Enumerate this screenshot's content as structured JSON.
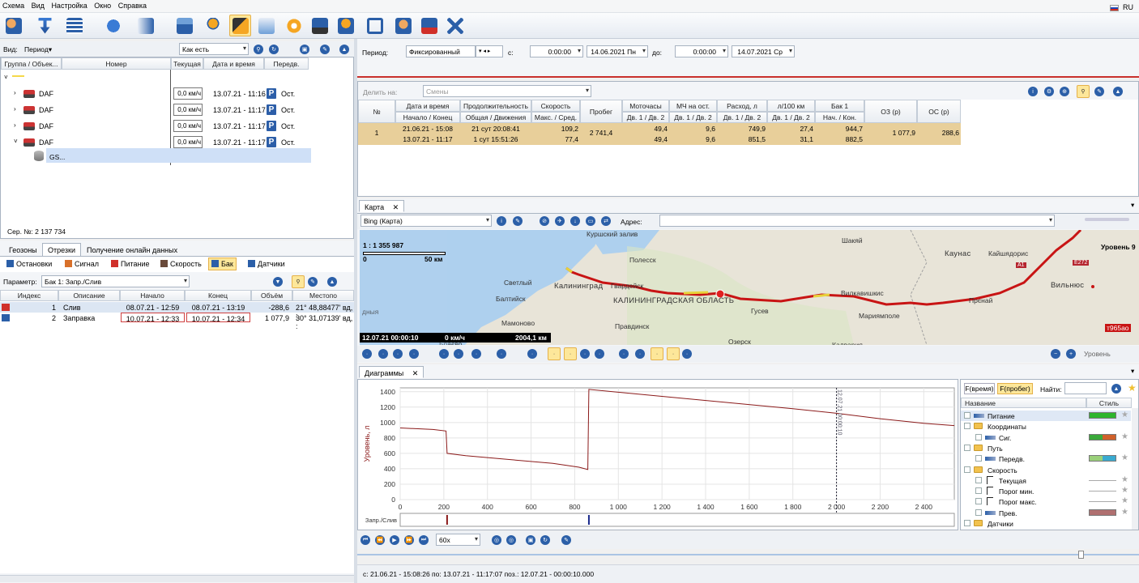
{
  "menu": [
    "Схема",
    "Вид",
    "Настройка",
    "Окно",
    "Справка"
  ],
  "lang": "RU",
  "left": {
    "view_label": "Вид:",
    "view_value": "Период",
    "mode_value": "Как есть",
    "columns": [
      "Группа / Объек...",
      "Номер",
      "Текущая",
      "Дата и время",
      "Передв."
    ],
    "rows": [
      {
        "name": "DAF",
        "speed": "0,0 км/ч",
        "dt": "13.07.21 - 11:16",
        "state": "Ост."
      },
      {
        "name": "DAF",
        "speed": "0,0 км/ч",
        "dt": "13.07.21 - 11:17",
        "state": "Ост."
      },
      {
        "name": "DAF",
        "speed": "0,0 км/ч",
        "dt": "13.07.21 - 11:17",
        "state": "Ост."
      },
      {
        "name": "DAF",
        "speed": "0,0 км/ч",
        "dt": "13.07.21 - 11:17",
        "state": "Ост."
      }
    ],
    "sub_item": "GS...",
    "serial": "Сер. №: 2 137 734",
    "tabs": [
      "Геозоны",
      "Отрезки",
      "Получение онлайн данных"
    ],
    "subtabs": [
      "Остановки",
      "Сигнал",
      "Питание",
      "Скорость",
      "Бак",
      "Датчики"
    ],
    "param_label": "Параметр:",
    "param_value": "Бак 1: Запр./Слив",
    "seg_columns": [
      "Индекс",
      "Описание",
      "Начало",
      "Конец",
      "Объём",
      "Местопо"
    ],
    "segments": [
      {
        "idx": "1",
        "desc": "Слив",
        "start": "08.07.21 - 12:59",
        "end": "08.07.21 - 13:19",
        "vol": "-288,6",
        "loc": "21° 48,88477' вд, :"
      },
      {
        "idx": "2",
        "desc": "Заправка",
        "start": "10.07.21 - 12:33",
        "end": "10.07.21 - 12:34",
        "vol": "1 077,9",
        "loc": "30° 31,07139' вд, :"
      }
    ]
  },
  "period": {
    "label": "Период:",
    "value": "Фиксированный",
    "from_label": "с:",
    "from_time": "0:00:00",
    "from_date": "14.06.2021 Пн",
    "to_label": "до:",
    "to_time": "0:00:00",
    "to_date": "14.07.2021 Ср"
  },
  "report": {
    "share_label": "Делить на:",
    "share_value": "Смены",
    "cols_top": [
      "№",
      "Дата и время",
      "Продолжительность",
      "Скорость",
      "Пробег",
      "Моточасы",
      "МЧ на ост.",
      "Расход, л",
      "л/100 км",
      "Бак 1",
      "ОЗ (р)",
      "ОС (р)"
    ],
    "cols_bottom": [
      "Начало / Конец",
      "Общая / Движения",
      "Макс. / Сред.",
      "Дв. 1 / Дв. 2",
      "Дв. 1 / Дв. 2",
      "Дв. 1 / Дв. 2",
      "Дв. 1 / Дв. 2",
      "Нач. / Кон."
    ],
    "row": {
      "num": "1",
      "dt1": "21.06.21 - 15:08",
      "dt2": "13.07.21 - 11:17",
      "dur1": "21 сут 20:08:41",
      "dur2": "1 сут 15:51:26",
      "sp1": "109,2",
      "sp2": "77,4",
      "mileage": "2 741,4",
      "mh1": "49,4",
      "mh2": "49,4",
      "mho1": "9,6",
      "mho2": "9,6",
      "fuel1": "749,9",
      "fuel2": "851,5",
      "l1001": "27,4",
      "l1002": "31,1",
      "tank1": "944,7",
      "tank2": "882,5",
      "oz": "1 077,9",
      "os": "288,6"
    }
  },
  "map": {
    "tab": "Карта",
    "provider": "Bing (Карта)",
    "addr_label": "Адрес:",
    "scale": "1 : 1 355 987",
    "scale_lbl0": "0",
    "scale_lbl1": "50 км",
    "status_date": "12.07.21 00:00:10",
    "status_speed": "0 км/ч",
    "status_dist": "2004,1 км",
    "level": "Уровень 9",
    "level_btn": "Уровень",
    "places": [
      "Куршский залив",
      "Полесск",
      "Светлый",
      "Калининград",
      "Гвардейск",
      "Балтийск",
      "КАЛИНИНГРАДСКАЯ ОБЛАСТЬ",
      "Гусев",
      "Мамоново",
      "Правдинск",
      "Озерск",
      "Шакяй",
      "Каунас",
      "Кайшядорис",
      "Вильнюс",
      "Прєнай",
      "Мариямполе",
      "Вилкавишкис",
      "Калвария",
      "Браєво",
      "дныя",
      "т965ао",
      "A1",
      "E272"
    ]
  },
  "chart": {
    "tab": "Диаграммы",
    "ylabel": "Уровень, л",
    "event_label": "Запр./Слив",
    "yticks": [
      "1400",
      "1200",
      "1000",
      "800",
      "600",
      "400",
      "200",
      "0"
    ],
    "xticks": [
      "0",
      "200",
      "400",
      "600",
      "800",
      "1 000",
      "1 200",
      "1 400",
      "1 600",
      "1 800",
      "2 000",
      "2 200",
      "2 400"
    ],
    "marker_text": "12.07.21 00:00:10"
  },
  "chart_data": {
    "type": "line",
    "title": "",
    "xlabel": "",
    "ylabel": "Уровень, л",
    "xlim": [
      0,
      2540
    ],
    "ylim": [
      0,
      1450
    ],
    "series": [
      {
        "name": "",
        "x": [
          0,
          150,
          210,
          215,
          300,
          500,
          700,
          820,
          860,
          865,
          1200,
          1500,
          1800,
          2000,
          2200,
          2400,
          2540
        ],
        "y": [
          930,
          910,
          890,
          600,
          570,
          520,
          470,
          420,
          390,
          1430,
          1340,
          1260,
          1180,
          1120,
          1050,
          990,
          960
        ]
      }
    ],
    "events": [
      {
        "x": 215,
        "color": "#8b1a1a"
      },
      {
        "x": 865,
        "color": "#1a2a8b"
      }
    ],
    "marker_x": 2000
  },
  "legend": {
    "btn_time": "F(время)",
    "btn_dist": "F(пробег)",
    "find_label": "Найти:",
    "col_name": "Название",
    "col_style": "Стиль",
    "items": [
      {
        "label": "Питание",
        "kind": "item",
        "indent": 0,
        "sw": "#2db52d"
      },
      {
        "label": "Координаты",
        "kind": "folder",
        "indent": 0
      },
      {
        "label": "Сиг.",
        "kind": "item",
        "indent": 1,
        "sw": "#3aa93a",
        "sw2": "#d0602a"
      },
      {
        "label": "Путь",
        "kind": "folder",
        "indent": 0
      },
      {
        "label": "Передв.",
        "kind": "item",
        "indent": 1,
        "sw": "#9ad07a",
        "sw2": "#3aaad0"
      },
      {
        "label": "Скорость",
        "kind": "folder",
        "indent": 0
      },
      {
        "label": "Текущая",
        "kind": "line",
        "indent": 1
      },
      {
        "label": "Порог мин.",
        "kind": "line",
        "indent": 1
      },
      {
        "label": "Порог макс.",
        "kind": "line",
        "indent": 1
      },
      {
        "label": "Прев.",
        "kind": "item",
        "indent": 1,
        "sw": "#b07070"
      },
      {
        "label": "Датчики",
        "kind": "folder",
        "indent": 0
      }
    ]
  },
  "player": {
    "speed": "60x"
  },
  "status": {
    "text": "с:  21.06.21 - 15:08:26  по:  13.07.21 - 11:17:07      поз.:  12.07.21 - 00:00:10.000"
  }
}
